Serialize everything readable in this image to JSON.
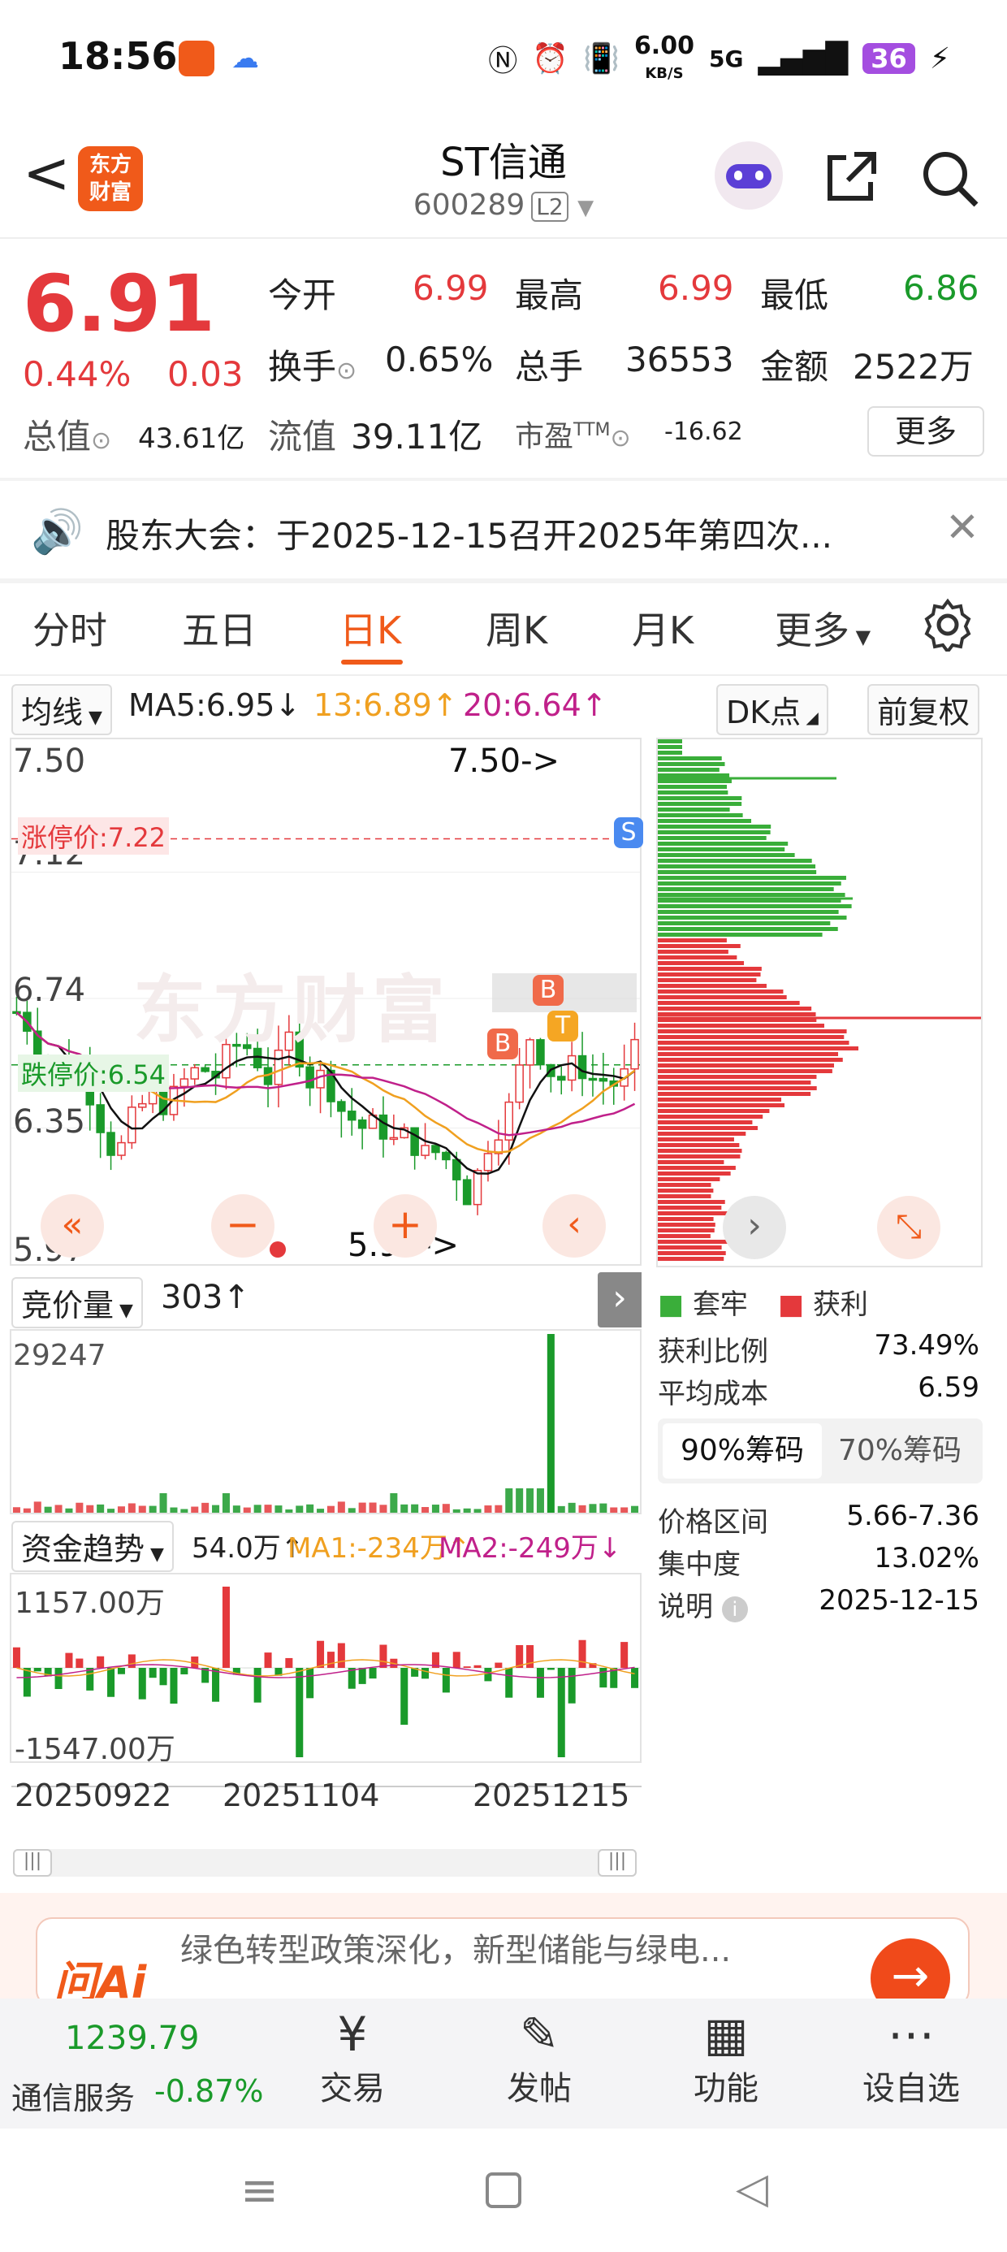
{
  "status_bar": {
    "time": "18:56",
    "net_speed": "6.00",
    "net_unit": "KB/S",
    "signal": "5G",
    "battery": "36"
  },
  "header": {
    "back": "<",
    "logo_text_1": "东方",
    "logo_text_2": "财富",
    "title": "ST信通",
    "code": "600289",
    "level": "L2",
    "share_icon": "share-icon",
    "search_icon": "search-icon"
  },
  "quote": {
    "price": "6.91",
    "change_pct": "0.44%",
    "change": "0.03",
    "open_label": "今开",
    "open": "6.99",
    "high_label": "最高",
    "high": "6.99",
    "low_label": "最低",
    "low": "6.86",
    "turnover_label": "换手",
    "turnover": "0.65%",
    "volume_label": "总手",
    "volume": "36553",
    "amount_label": "金额",
    "amount": "2522万",
    "mcap_label": "总值",
    "mcap": "43.61亿",
    "float_label": "流值",
    "float": "39.11亿",
    "pe_label": "市盈",
    "pe_sup": "TTM",
    "pe": "-16.62",
    "more": "更多"
  },
  "notice": {
    "text": "股东大会：于2025-12-15召开2025年第四次..."
  },
  "tabs": [
    "分时",
    "五日",
    "日K",
    "周K",
    "月K",
    "更多"
  ],
  "active_tab": 2,
  "toolbar": {
    "ma_select": "均线",
    "ma5": "MA5:6.95↓",
    "ma13": "13:6.89↑",
    "ma20": "20:6.64↑",
    "dk": "DK点",
    "fq": "前复权"
  },
  "kchart": {
    "y_labels": [
      "7.50",
      "7.12",
      "6.74",
      "6.35",
      "5.97"
    ],
    "limit_up": "涨停价:7.22",
    "limit_down": "跌停价:6.54",
    "high_mark": "7.50->",
    "low_mark": "5.97->",
    "watermark": "东方财富",
    "signals": [
      "B",
      "B",
      "T",
      "S"
    ]
  },
  "auction": {
    "select": "竞价量",
    "value": "303↑",
    "max": "29247"
  },
  "flow": {
    "select": "资金趋势",
    "value": "54.0万↑",
    "ma1": "MA1:-234万↑",
    "ma2": "MA2:-249万↓",
    "max": "1157.00万",
    "min": "-1547.00万"
  },
  "dates": [
    "20250922",
    "20251104",
    "20251215"
  ],
  "chips": {
    "legend_trapped": "套牢",
    "legend_profit": "获利",
    "rows": [
      {
        "label": "获利比例",
        "value": "73.49%"
      },
      {
        "label": "平均成本",
        "value": "6.59"
      }
    ],
    "tab_90": "90%筹码",
    "tab_70": "70%筹码",
    "rows2": [
      {
        "label": "价格区间",
        "value": "5.66-7.36"
      },
      {
        "label": "集中度",
        "value": "13.02%"
      },
      {
        "label": "说明",
        "value": "2025-12-15"
      }
    ]
  },
  "ad": {
    "logo": "问Ai",
    "text": "绿色转型政策深化，新型储能与绿电..."
  },
  "bottom": {
    "index_value": "1239.79",
    "index_name": "通信服务",
    "index_change": "-0.87%",
    "items": [
      "交易",
      "发帖",
      "功能",
      "设自选"
    ]
  },
  "colors": {
    "up": "#e4393c",
    "down": "#1a9a2a",
    "accent": "#f05a1a",
    "ma5": "#111111",
    "ma13": "#f0a020",
    "ma20": "#c0208a"
  }
}
